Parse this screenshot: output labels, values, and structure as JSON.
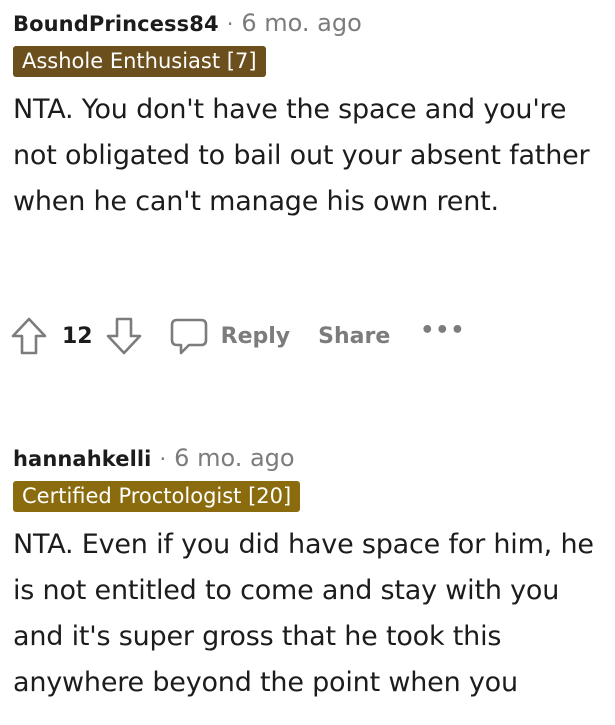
{
  "comments": [
    {
      "username": "BoundPrincess84",
      "separator": "·",
      "timestamp": "6 mo. ago",
      "flair": {
        "text": "Asshole Enthusiast [7]",
        "color": "#6b4f1d"
      },
      "body": "NTA. You don't have the space and you're not obligated to bail out your absent father when he can't manage his own rent.",
      "score": "12",
      "reply_label": "Reply",
      "share_label": "Share",
      "more_label": "•••",
      "icons": [
        "upvote-icon",
        "downvote-icon",
        "comment-bubble-icon",
        "more-dots-icon"
      ]
    },
    {
      "username": "hannahkelli",
      "separator": "·",
      "timestamp": "6 mo. ago",
      "flair": {
        "text": "Certified Proctologist [20]",
        "color": "#8a6c0f"
      },
      "body": "NTA. Even if you did have space for him, he is not entitled to come and stay with you and it's super gross that he took this anywhere beyond the point when you"
    }
  ],
  "colors": {
    "text": "#1c1c1c",
    "muted": "#7c7c7c",
    "icon": "#7c7c7c",
    "background": "#ffffff"
  }
}
